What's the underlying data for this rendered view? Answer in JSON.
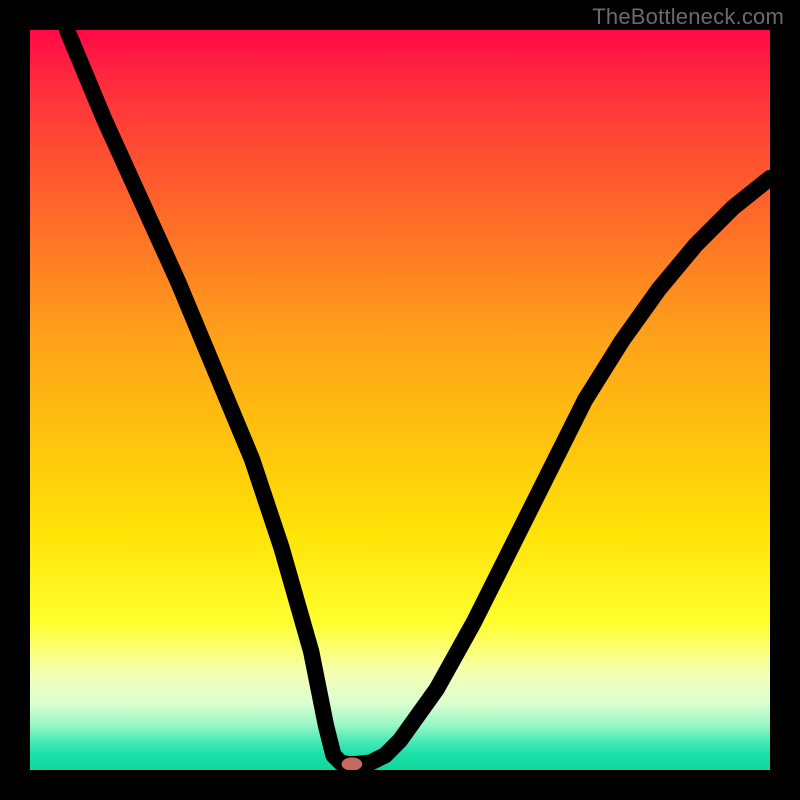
{
  "watermark": "TheBottleneck.com",
  "chart_data": {
    "type": "line",
    "title": "",
    "xlabel": "",
    "ylabel": "",
    "xlim": [
      0,
      100
    ],
    "ylim": [
      0,
      100
    ],
    "grid": false,
    "legend": false,
    "series": [
      {
        "name": "bottleneck-curve",
        "x": [
          5,
          10,
          15,
          20,
          25,
          30,
          34,
          38,
          40,
          41,
          42,
          43,
          44,
          46,
          48,
          50,
          55,
          60,
          65,
          70,
          75,
          80,
          85,
          90,
          95,
          100
        ],
        "y": [
          100,
          88,
          77,
          66,
          54,
          42,
          30,
          16,
          6,
          2,
          1,
          0.8,
          0.8,
          1,
          2,
          4,
          11,
          20,
          30,
          40,
          50,
          58,
          65,
          71,
          76,
          80
        ]
      }
    ],
    "marker": {
      "x": 43.5,
      "y": 0.8,
      "color": "#c46a5f",
      "rx": 1.4,
      "ry": 0.9
    },
    "gradient_stops": [
      {
        "pct": 0,
        "color": "#ff0a46"
      },
      {
        "pct": 8,
        "color": "#ff2f3c"
      },
      {
        "pct": 18,
        "color": "#ff5330"
      },
      {
        "pct": 30,
        "color": "#ff7a24"
      },
      {
        "pct": 42,
        "color": "#ffa319"
      },
      {
        "pct": 55,
        "color": "#ffc20e"
      },
      {
        "pct": 68,
        "color": "#ffe307"
      },
      {
        "pct": 80,
        "color": "#ffff2e"
      },
      {
        "pct": 87,
        "color": "#f6ffb4"
      },
      {
        "pct": 91,
        "color": "#d9ffd0"
      },
      {
        "pct": 94,
        "color": "#96f7c3"
      },
      {
        "pct": 96,
        "color": "#4de9b8"
      },
      {
        "pct": 98,
        "color": "#1adfa9"
      },
      {
        "pct": 100,
        "color": "#10d89d"
      }
    ]
  }
}
